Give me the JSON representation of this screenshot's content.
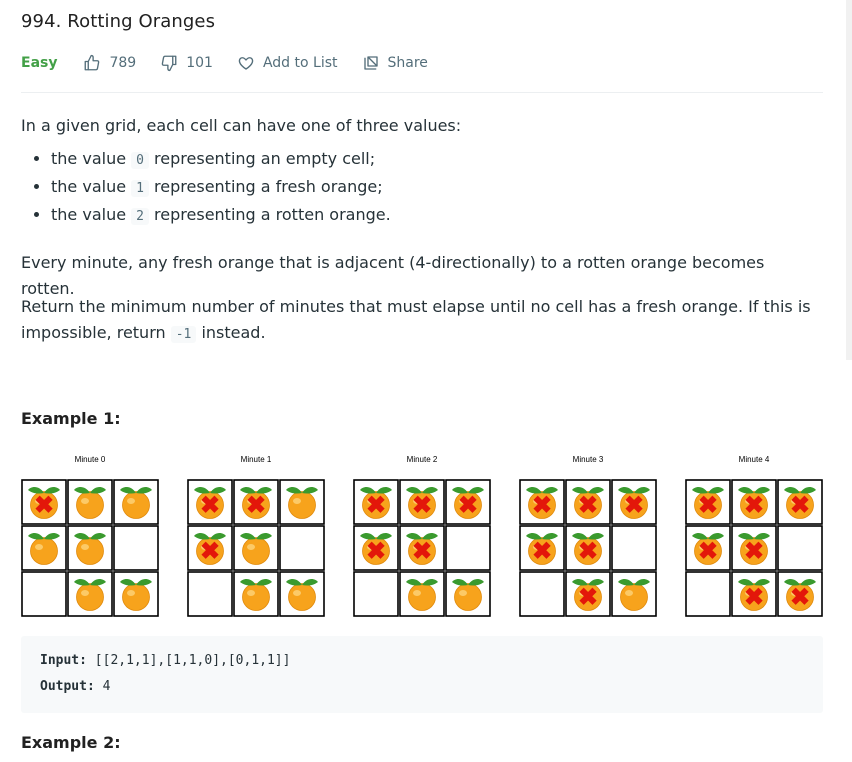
{
  "problem": {
    "title": "994. Rotting Oranges",
    "difficulty": "Easy",
    "likes": "789",
    "dislikes": "101",
    "add_to_list": "Add to List",
    "share": "Share"
  },
  "description": {
    "intro": "In a given grid, each cell can have one of three values:",
    "bullets": [
      {
        "pre": "the value ",
        "code": "0",
        "post": " representing an empty cell;"
      },
      {
        "pre": "the value ",
        "code": "1",
        "post": " representing a fresh orange;"
      },
      {
        "pre": "the value ",
        "code": "2",
        "post": " representing a rotten orange."
      }
    ],
    "para2": "Every minute, any fresh orange that is adjacent (4-directionally) to a rotten orange becomes rotten.",
    "para3_pre": "Return the minimum number of minutes that must elapse until no cell has a fresh orange.  If this is impossible, return ",
    "para3_code": "-1",
    "para3_post": " instead."
  },
  "example1": {
    "heading": "Example 1:",
    "panels": [
      {
        "label": "Minute 0",
        "grid": [
          [
            2,
            1,
            1
          ],
          [
            1,
            1,
            0
          ],
          [
            0,
            1,
            1
          ]
        ]
      },
      {
        "label": "Minute 1",
        "grid": [
          [
            2,
            2,
            1
          ],
          [
            2,
            1,
            0
          ],
          [
            0,
            1,
            1
          ]
        ]
      },
      {
        "label": "Minute 2",
        "grid": [
          [
            2,
            2,
            2
          ],
          [
            2,
            2,
            0
          ],
          [
            0,
            1,
            1
          ]
        ]
      },
      {
        "label": "Minute 3",
        "grid": [
          [
            2,
            2,
            2
          ],
          [
            2,
            2,
            0
          ],
          [
            0,
            2,
            1
          ]
        ]
      },
      {
        "label": "Minute 4",
        "grid": [
          [
            2,
            2,
            2
          ],
          [
            2,
            2,
            0
          ],
          [
            0,
            2,
            2
          ]
        ]
      }
    ],
    "input_label": "Input:",
    "input_value": "[[2,1,1],[1,1,0],[0,1,1]]",
    "output_label": "Output:",
    "output_value": "4"
  },
  "example2": {
    "heading": "Example 2:"
  },
  "colors": {
    "easy": "#43a047",
    "orange": "#f7a31c",
    "leaf": "#3a9a2e",
    "rot_x": "#e3170a",
    "code_bg": "#f7f9fa"
  }
}
